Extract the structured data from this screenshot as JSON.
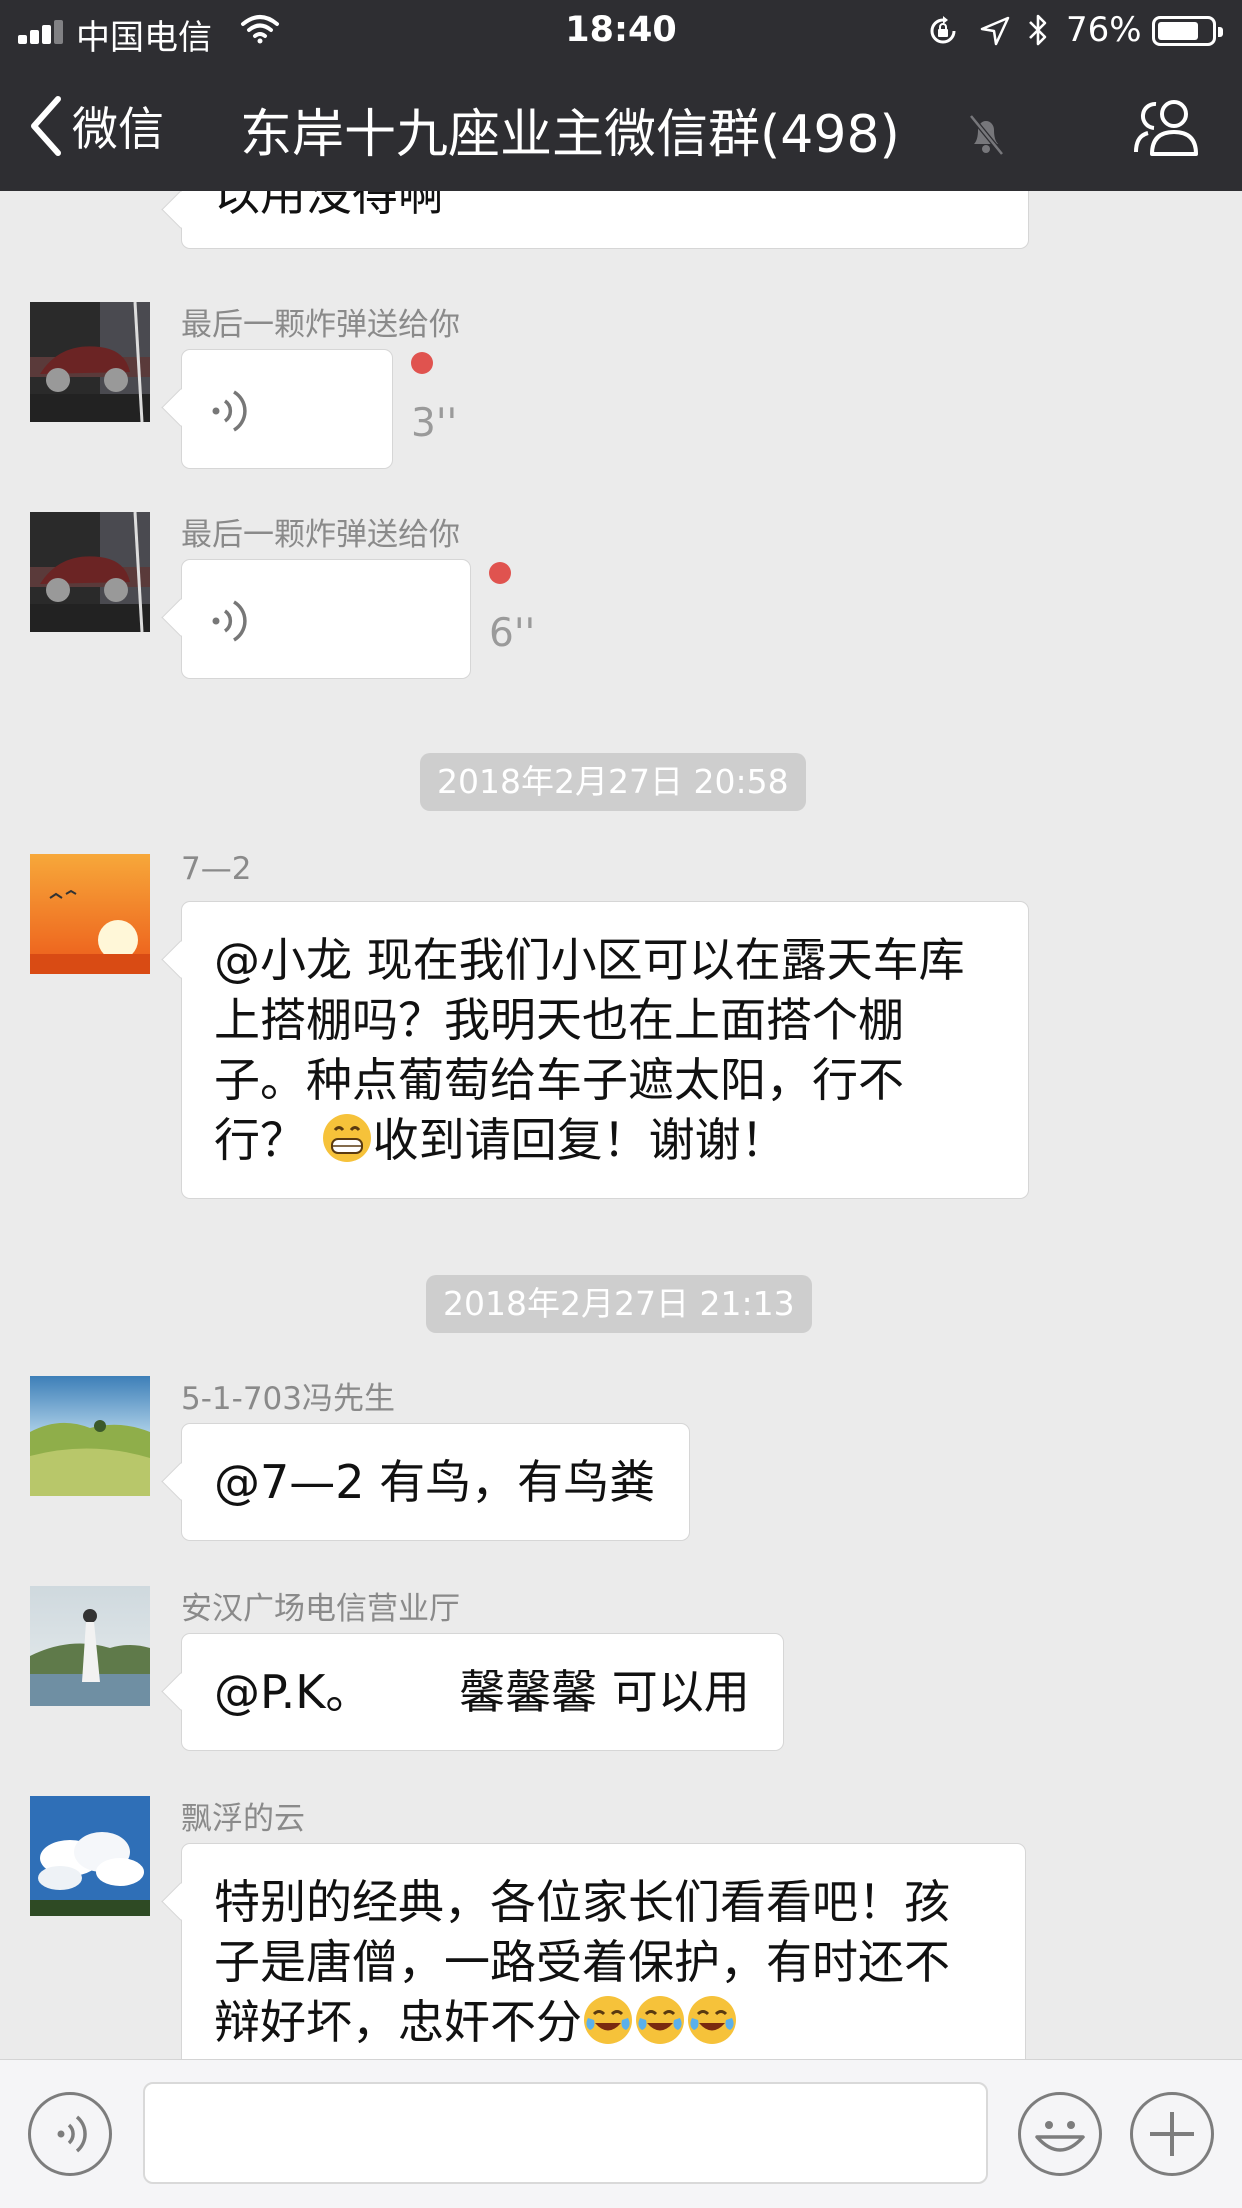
{
  "status_bar": {
    "carrier": "中国电信",
    "time": "18:40",
    "battery_percent": "76%",
    "battery_level": 0.76
  },
  "nav": {
    "back_label": "微信",
    "title": "东岸十九座业主微信群(498)"
  },
  "messages": {
    "partial_text": "以用没得啊",
    "voice1": {
      "sender": "最后一颗炸弹送给你",
      "duration": "3''"
    },
    "voice2": {
      "sender": "最后一颗炸弹送给你",
      "duration": "6''"
    },
    "timestamp1": "2018年2月27日 20:58",
    "msg_7_2": {
      "sender": "7—2",
      "line1": "@小龙 现在我们小区可以在露天车库",
      "line2": "上搭棚吗？我明天也在上面搭个棚",
      "line3": "子。种点葡萄给车子遮太阳，行不",
      "line4_a": "行？",
      "line4_b": "收到请回复！谢谢！"
    },
    "timestamp2": "2018年2月27日 21:13",
    "msg_feng": {
      "sender": "5-1-703冯先生",
      "text": "@7—2 有鸟，有鸟粪"
    },
    "msg_anhan": {
      "sender": "安汉广场电信营业厅",
      "text": "@P.K。      馨馨馨 可以用"
    },
    "msg_yun": {
      "sender": "飘浮的云",
      "line1": "特别的经典，各位家长们看看吧！孩",
      "line2": "子是唐僧，一路受着保护，有时还不",
      "line3": "辩好坏，忠奸不分"
    }
  },
  "input": {
    "value": ""
  },
  "colors": {
    "nav_background": "#2e2e32",
    "chat_background": "#ebebeb",
    "unread_dot": "#e0534f",
    "timestamp_pill": "#cecece"
  },
  "icons": {
    "back": "chevron-left-icon",
    "mute": "bell-muted-icon",
    "members": "people-icon",
    "voice_wave": "voice-wave-icon",
    "voice_toggle": "voice-toggle-icon",
    "emoji": "smiley-icon",
    "more": "plus-icon",
    "grin": "grinning-emoji-icon",
    "cry": "crying-laughing-emoji-icon"
  }
}
